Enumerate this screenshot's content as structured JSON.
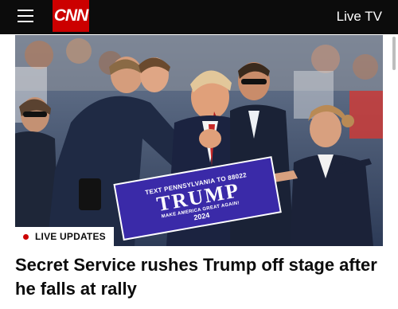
{
  "header": {
    "logo_text": "CNN",
    "live_tv_label": "Live TV",
    "menu_icon": "hamburger-menu-icon",
    "brand_color": "#cc0000"
  },
  "hero": {
    "sign": {
      "top_line": "TEXT PENNSYLVANIA TO 88022",
      "name": "TRUMP",
      "tagline": "MAKE AMERICA GREAT AGAIN!",
      "year": "2024"
    }
  },
  "badge": {
    "label": "LIVE UPDATES",
    "dot_color": "#cc0000"
  },
  "article": {
    "headline": "Secret Service rushes Trump off stage after he falls at rally"
  }
}
